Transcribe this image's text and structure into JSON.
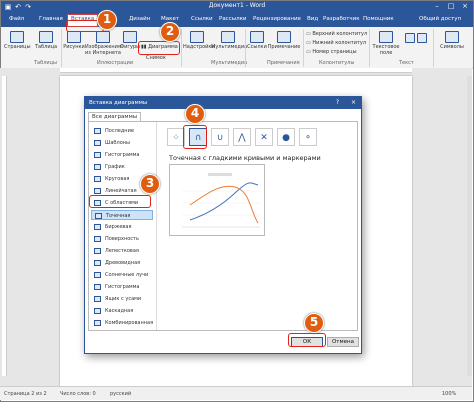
{
  "window": {
    "title": "Документ1 - Word",
    "user": "Общий доступ"
  },
  "tabs": [
    "Файл",
    "Главная",
    "Вставка",
    "Дизайн",
    "Макет",
    "Ссылки",
    "Рассылки",
    "Рецензирование",
    "Вид",
    "Разработчик",
    "Помощник"
  ],
  "ribbon": {
    "pages": "Страницы",
    "table": "Таблица",
    "pictures": "Рисунки",
    "online": "Изображения из Интернета",
    "shapes": "Фигуры",
    "diagram": "Диаграмма",
    "snapshot": "Снимок",
    "addins": "Надстройки",
    "media": "Мультимедиа",
    "links": "Ссылки",
    "comment": "Примечание",
    "header": "Верхний колонтитул",
    "footer": "Нижний колонтитул",
    "pagenum": "Номер страницы",
    "textbox": "Текстовое поле",
    "symbols": "Символы",
    "groups": {
      "tables": "Таблицы",
      "illustrations": "Иллюстрации",
      "media": "Мультимедиа",
      "comments": "Примечания",
      "headers": "Колонтитулы",
      "text": "Текст"
    }
  },
  "dialog": {
    "title": "Вставка диаграммы",
    "tab": "Все диаграммы",
    "help": "?",
    "close": "×",
    "list": [
      "Последние",
      "Шаблоны",
      "Гистограмма",
      "График",
      "Круговая",
      "Линейчатая",
      "С областями",
      "Точечная",
      "Биржевая",
      "Поверхность",
      "Лепестковая",
      "Древовидная",
      "Солнечные лучи",
      "Гистограмма",
      "Ящик с усами",
      "Каскадная",
      "Комбинированная"
    ],
    "selected_index": 7,
    "subtype_title": "Точечная с гладкими кривыми и маркерами",
    "ok": "ОК",
    "cancel": "Отмена"
  },
  "status": {
    "page": "Страница 2 из 2",
    "words": "Число слов: 0",
    "lang": "русский",
    "zoom": "100%"
  },
  "steps": [
    "1",
    "2",
    "3",
    "4",
    "5"
  ],
  "colors": {
    "brand": "#2b579a",
    "marker": "#e05d10",
    "highlight": "#e0221a"
  }
}
